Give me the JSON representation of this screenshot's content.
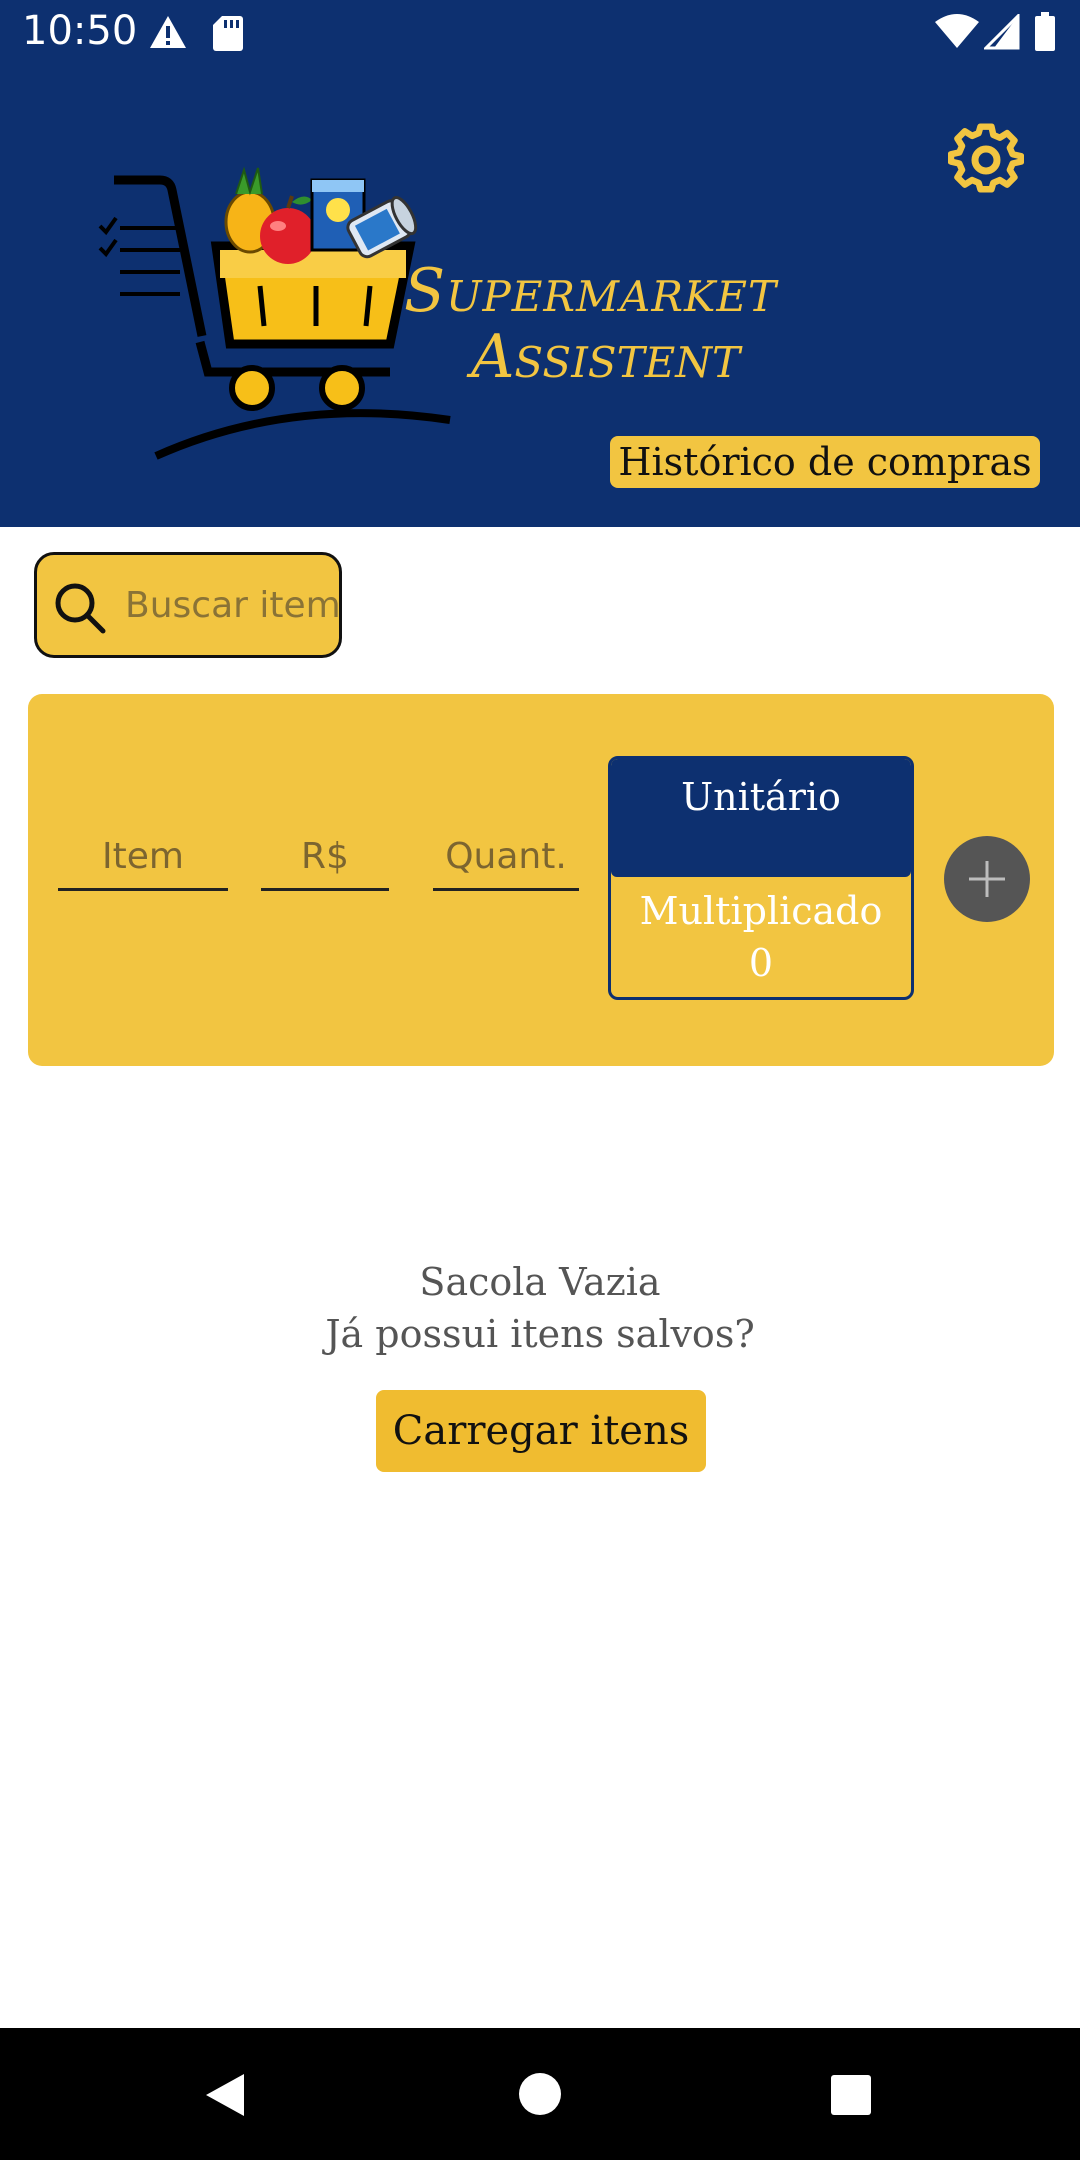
{
  "status_bar": {
    "time": "10:50",
    "icons": [
      "warning-icon",
      "sd-card-icon",
      "wifi-icon",
      "signal-icon",
      "battery-icon"
    ]
  },
  "header": {
    "brand_line1": "Supermarket",
    "brand_line2": "Assistent",
    "history_button": "Histórico de compras",
    "settings_icon": "gear-icon",
    "logo": "shopping-cart-logo"
  },
  "search": {
    "placeholder": "Buscar item",
    "value": ""
  },
  "entry_form": {
    "item_label": "Item",
    "price_label": "R$",
    "quantity_label": "Quant.",
    "mode_unit_label": "Unitário",
    "mode_multiplied_label": "Multiplicado",
    "multiplied_value": "0",
    "add_icon": "plus-icon"
  },
  "empty_state": {
    "title": "Sacola Vazia",
    "subtitle": "Já possui itens salvos?",
    "load_button": "Carregar itens"
  },
  "nav_bar": {
    "icons": [
      "back-icon",
      "home-icon",
      "recents-icon"
    ]
  },
  "colors": {
    "primary_navy": "#0d3070",
    "accent_yellow": "#f2c541",
    "button_yellow": "#f0bc30",
    "add_button_gray": "#555555"
  }
}
